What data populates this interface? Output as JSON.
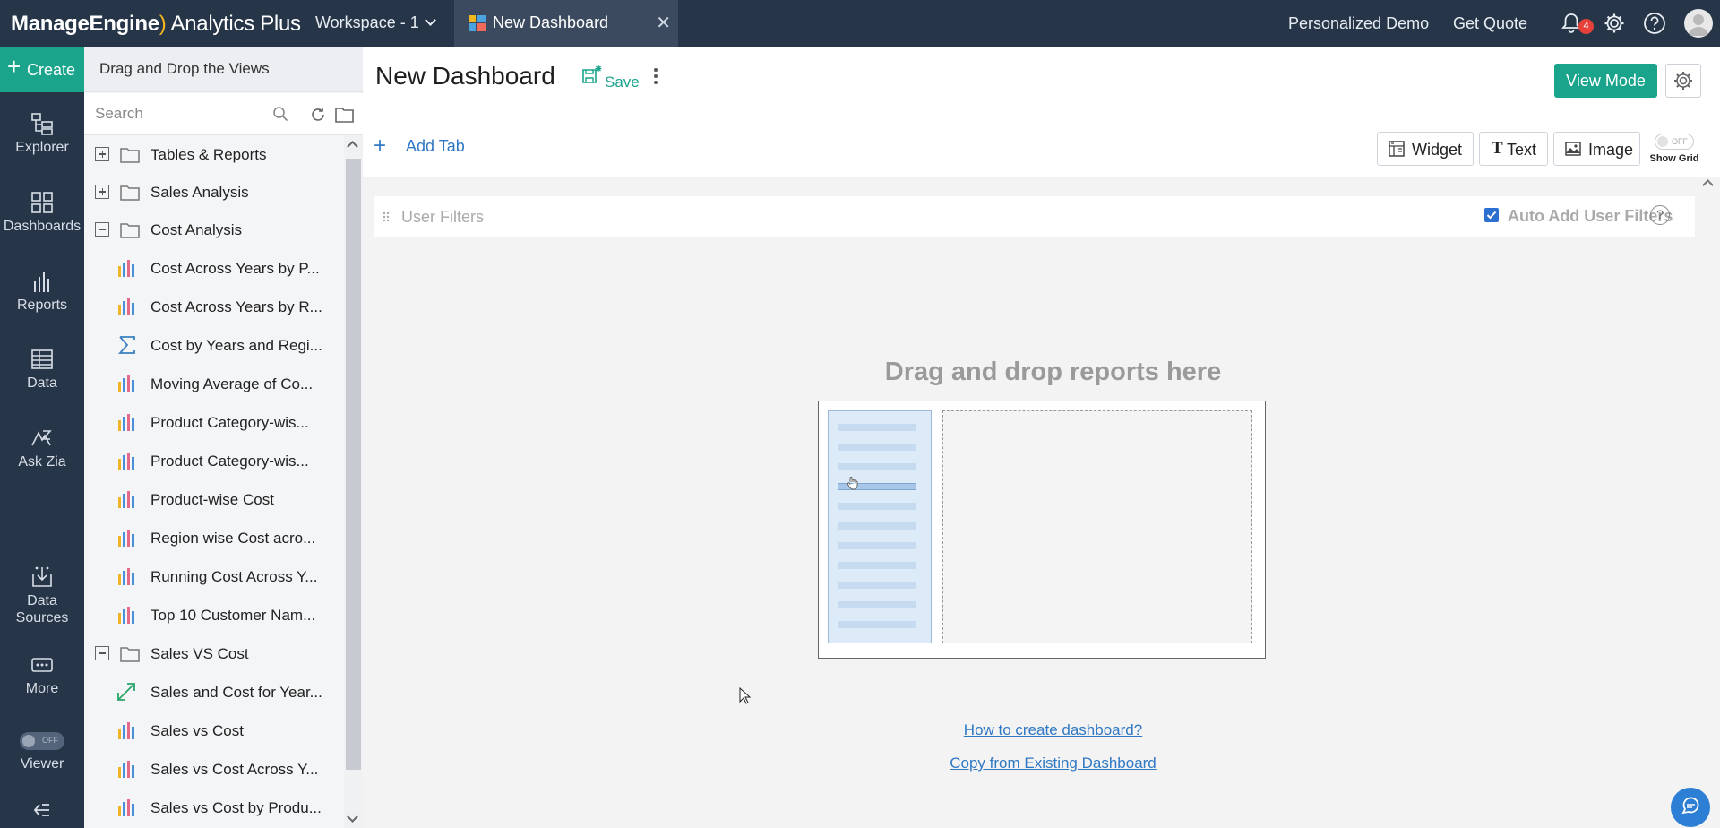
{
  "topbar": {
    "brand_part1": "ManageEngine",
    "brand_part2": "Analytics Plus",
    "workspace": "Workspace - 1",
    "tab_title": "New Dashboard",
    "personalized_demo": "Personalized Demo",
    "get_quote": "Get Quote",
    "notification_count": "4",
    "colors": {
      "bar": "#263548",
      "active_tab": "#3b4a5e",
      "badge": "#e5413a"
    }
  },
  "leftnav": {
    "create_label": "Create",
    "items": [
      {
        "label": "Explorer",
        "icon": "explorer-icon"
      },
      {
        "label": "Dashboards",
        "icon": "dashboards-icon"
      },
      {
        "label": "Reports",
        "icon": "reports-icon"
      },
      {
        "label": "Data",
        "icon": "data-icon"
      },
      {
        "label": "Ask Zia",
        "icon": "ask-zia-icon"
      },
      {
        "label": "Data Sources",
        "icon": "data-sources-icon"
      },
      {
        "label": "More",
        "icon": "more-icon"
      },
      {
        "label": "Viewer",
        "icon": "viewer-toggle"
      }
    ],
    "viewer_toggle_state": "OFF",
    "accent": "#1aa48c"
  },
  "panel": {
    "header": "Drag and Drop the Views",
    "search_placeholder": "Search",
    "tree": [
      {
        "type": "folder",
        "label": "Tables & Reports",
        "expanded": false
      },
      {
        "type": "folder",
        "label": "Sales Analysis",
        "expanded": false
      },
      {
        "type": "folder",
        "label": "Cost Analysis",
        "expanded": true
      },
      {
        "type": "chart",
        "label": "Cost Across Years by P..."
      },
      {
        "type": "chart",
        "label": "Cost Across Years by R..."
      },
      {
        "type": "pivot",
        "label": "Cost by Years and Regi..."
      },
      {
        "type": "chart",
        "label": "Moving Average of Co..."
      },
      {
        "type": "chart",
        "label": "Product Category-wis..."
      },
      {
        "type": "chart",
        "label": "Product Category-wis..."
      },
      {
        "type": "chart",
        "label": "Product-wise Cost"
      },
      {
        "type": "chart",
        "label": "Region wise Cost acro..."
      },
      {
        "type": "chart",
        "label": "Running Cost Across Y..."
      },
      {
        "type": "chart",
        "label": "Top 10 Customer Nam..."
      },
      {
        "type": "folder",
        "label": "Sales VS Cost",
        "expanded": true
      },
      {
        "type": "scatter",
        "label": "Sales and Cost for Year..."
      },
      {
        "type": "chart",
        "label": "Sales vs Cost"
      },
      {
        "type": "chart",
        "label": "Sales vs Cost Across Y..."
      },
      {
        "type": "chart",
        "label": "Sales vs Cost by Produ..."
      }
    ]
  },
  "main": {
    "title": "New Dashboard",
    "save_label": "Save",
    "view_mode_label": "View Mode",
    "add_tab_label": "Add Tab",
    "tools": {
      "widget": "Widget",
      "text": "Text",
      "image": "Image"
    },
    "show_grid_label": "Show Grid",
    "show_grid_state": "OFF",
    "user_filters_label": "User Filters",
    "auto_add_label": "Auto Add User Filters",
    "auto_add_checked": true,
    "help_glyph": "?",
    "dropzone_title": "Drag and drop reports here",
    "how_to_link": "How to create dashboard?",
    "copy_link": "Copy from Existing Dashboard"
  }
}
